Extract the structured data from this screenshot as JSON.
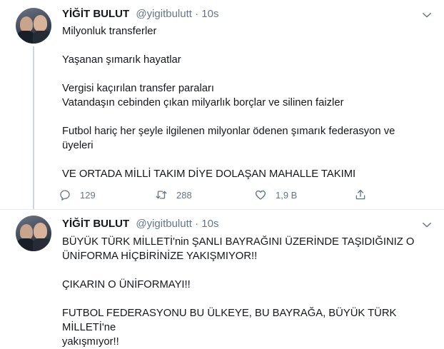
{
  "tweets": [
    {
      "author": {
        "name": "YİĞİT BULUT",
        "handle": "@yigitbulutt",
        "separator": "·",
        "time": "10s"
      },
      "paragraphs": [
        {
          "lines": [
            "Milyonluk transferler"
          ]
        },
        {
          "lines": [
            "Yaşanan şımarık hayatlar"
          ]
        },
        {
          "lines": [
            "Vergisi kaçırılan transfer paraları",
            "Vatandaşın cebinden çıkan milyarlık borçlar ve silinen faizler"
          ]
        },
        {
          "lines": [
            "Futbol hariç her şeyle ilgilenen milyonlar ödenen şımarık federasyon ve",
            "üyeleri"
          ]
        },
        {
          "lines": [
            "VE ORTADA MİLLİ TAKIM DİYE DOLAŞAN MAHALLE TAKIMI"
          ]
        }
      ],
      "actions": {
        "replies": "129",
        "retweets": "288",
        "likes": "1,9 B"
      }
    },
    {
      "author": {
        "name": "YİĞİT BULUT",
        "handle": "@yigitbulutt",
        "separator": "·",
        "time": "10s"
      },
      "paragraphs": [
        {
          "lines": [
            "BÜYÜK TÜRK MİLLETİ'nin ŞANLI BAYRAĞINI ÜZERİNDE TAŞIDIĞINIZ O",
            "ÜNİFORMA HİÇBİRİNİZE YAKIŞMIYOR!!"
          ]
        },
        {
          "lines": [
            "ÇIKARIN O ÜNİFORMAYI!!"
          ]
        },
        {
          "lines": [
            "FUTBOL FEDERASYONU BU ÜLKEYE, BU BAYRAĞA, BÜYÜK TÜRK MİLLETİ'ne",
            "yakışmıyor!!"
          ]
        }
      ]
    }
  ],
  "icons": {
    "reply": "reply-icon",
    "retweet": "retweet-icon",
    "like": "heart-icon",
    "share": "share-icon",
    "more": "chevron-down-icon"
  },
  "colors": {
    "text": "#14171a",
    "secondary": "#657786",
    "divider": "#e6ecf0",
    "thread": "#ccd6dd"
  }
}
